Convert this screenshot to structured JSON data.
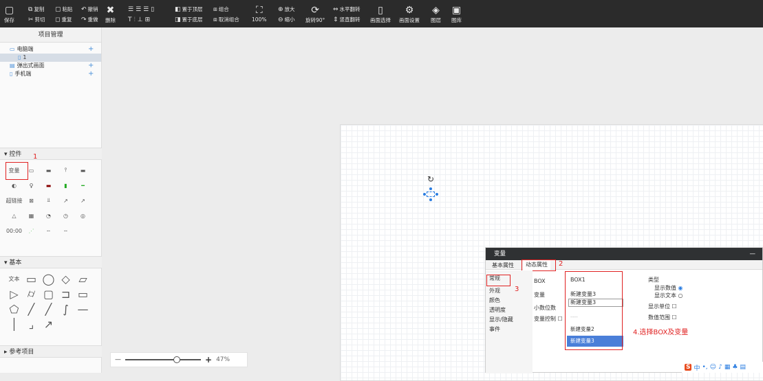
{
  "colors": {
    "toolbar": "#2b2b2b",
    "accent": "#4a90d9",
    "red": "#e02020",
    "selected": "#4a7fd9"
  },
  "toolbar": {
    "save": "保存",
    "copy": "复制",
    "cut": "剪切",
    "paste": "粘贴",
    "redo_left": "重复",
    "undo": "撤销",
    "redo": "重做",
    "delete": "删除",
    "bring_top": "置于顶层",
    "send_bottom": "置于底层",
    "group": "组合",
    "ungroup": "取消组合",
    "zoom_pct": "100%",
    "zoom_in": "放大",
    "zoom_out": "缩小",
    "rotate": "旋转90°",
    "flip_h": "水平翻转",
    "flip_v": "竖直翻转",
    "canvas_select": "画面选择",
    "canvas_settings": "画面设置",
    "layers": "图层",
    "gallery": "图库"
  },
  "sidebar": {
    "project_title": "项目管理",
    "tree": [
      {
        "label": "电脑端",
        "icon": "monitor-icon"
      },
      {
        "label": "1",
        "icon": "page-icon"
      },
      {
        "label": "弹出式画面",
        "icon": "popup-icon"
      },
      {
        "label": "手机端",
        "icon": "phone-icon"
      }
    ],
    "controls_title": "控件",
    "controls_note": "1",
    "var_label": "变量",
    "link_label": "超链接",
    "time_label": "00:00",
    "basic_title": "基本",
    "text_label": "文本",
    "ref_title": "参考项目"
  },
  "zoom": {
    "value": "47%",
    "minus": "—",
    "plus": "+"
  },
  "variable_panel": {
    "title": "变量",
    "minimize": "—",
    "tab_basic": "基本属性",
    "tab_dynamic": "动态属性",
    "tab_note": "2",
    "categories": [
      "常规",
      "外观",
      "颜色",
      "透明度",
      "显示/隐藏",
      "事件"
    ],
    "cat_note": "3",
    "box_label": "BOX",
    "var_label": "变量",
    "decimal_label": "小数位数",
    "varctl_label": "变量控制",
    "box_value": "BOX1",
    "var_value": "新建变量3",
    "input_value": "新建变量3",
    "dashes": "----",
    "options": [
      "新建变量2",
      "新建变量3"
    ],
    "type_label": "类型",
    "show_value": "显示数值",
    "show_text": "显示文本",
    "show_unit": "显示单位",
    "value_range": "数值范围",
    "instruction": "4.选择BOX及变量"
  },
  "tray": {
    "ime": "中"
  }
}
